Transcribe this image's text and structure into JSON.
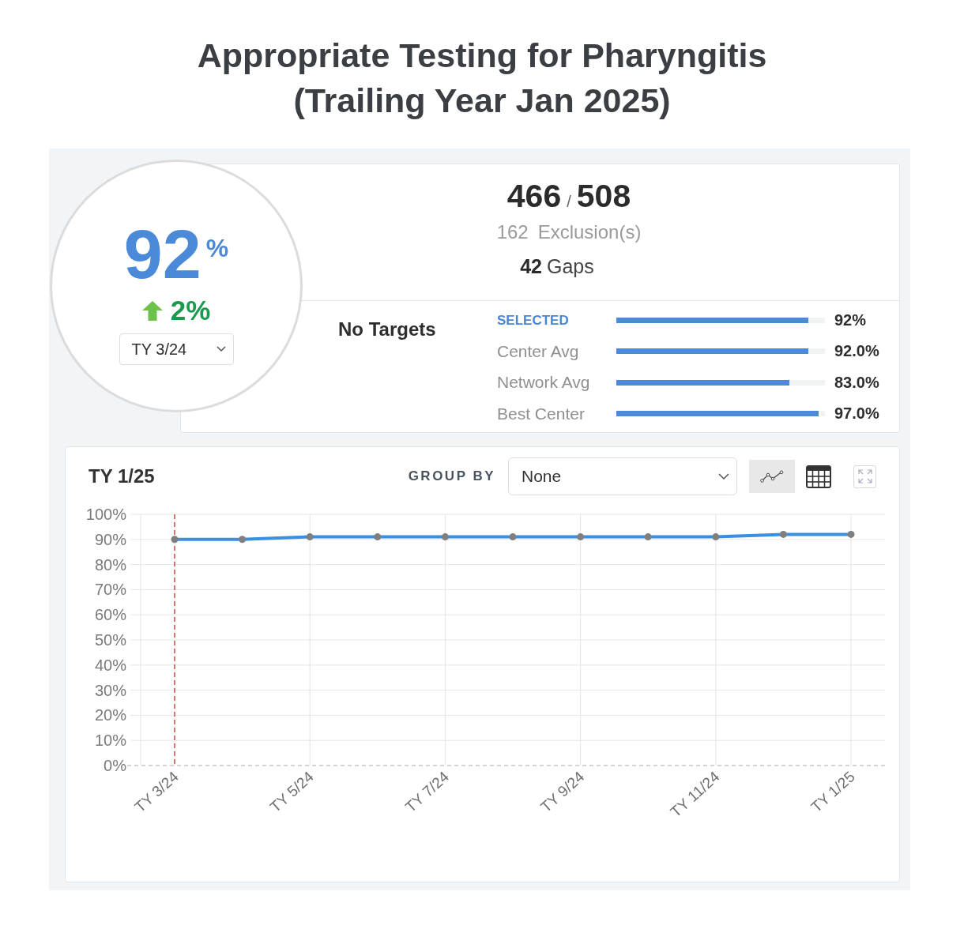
{
  "title": "Appropriate Testing for Pharyngitis (Trailing Year Jan 2025)",
  "score": {
    "value": "92",
    "unit": "%",
    "change": {
      "rising": true,
      "text": "2%"
    },
    "period_select": {
      "value": "TY 3/24"
    }
  },
  "counts": {
    "numerator": "466",
    "separator": "/",
    "denominator": "508",
    "exclusions": {
      "count": "162",
      "label": "Exclusion(s)"
    },
    "gaps": {
      "count": "42",
      "label": "Gaps"
    }
  },
  "target": "No Targets",
  "comparisons": [
    {
      "kind": "current",
      "label": "SELECTED",
      "level": 0.92,
      "reading": "92%"
    },
    {
      "kind": "benchmark",
      "label": "Center Avg",
      "level": 0.92,
      "reading": "92.0%"
    },
    {
      "kind": "benchmark",
      "label": "Network Avg",
      "level": 0.83,
      "reading": "83.0%"
    },
    {
      "kind": "benchmark",
      "label": "Best Center",
      "level": 0.97,
      "reading": "97.0%"
    }
  ],
  "trend": {
    "period": "TY 1/25",
    "group_by": {
      "label": "GROUP BY",
      "value": "None"
    },
    "view_buttons": [
      {
        "kind": "line",
        "selected": true
      },
      {
        "kind": "table",
        "selected": false
      }
    ],
    "chart_data": {
      "type": "line",
      "categories": [
        "TY 3/24",
        null,
        "TY 5/24",
        null,
        "TY 7/24",
        null,
        "TY 9/24",
        null,
        "TY 11/24",
        null,
        "TY 1/25"
      ],
      "ylim": [
        0,
        100
      ],
      "yticks": [
        {
          "value": 0,
          "label": "0%"
        },
        {
          "value": 10,
          "label": "10%"
        },
        {
          "value": 20,
          "label": "20%"
        },
        {
          "value": 30,
          "label": "30%"
        },
        {
          "value": 40,
          "label": "40%"
        },
        {
          "value": 50,
          "label": "50%"
        },
        {
          "value": 60,
          "label": "60%"
        },
        {
          "value": 70,
          "label": "70%"
        },
        {
          "value": 80,
          "label": "80%"
        },
        {
          "value": 90,
          "label": "90%"
        },
        {
          "value": 100,
          "label": "100%"
        }
      ],
      "grid": true,
      "series": [
        {
          "color": "#3a8fe3",
          "marker": "circle",
          "values": [
            90,
            90,
            91,
            91,
            91,
            91,
            91,
            91,
            91,
            92,
            92
          ]
        }
      ],
      "ref_lines": [
        {
          "axis": "x",
          "value": "TY 3/24",
          "color": "#c0504d"
        }
      ]
    }
  }
}
